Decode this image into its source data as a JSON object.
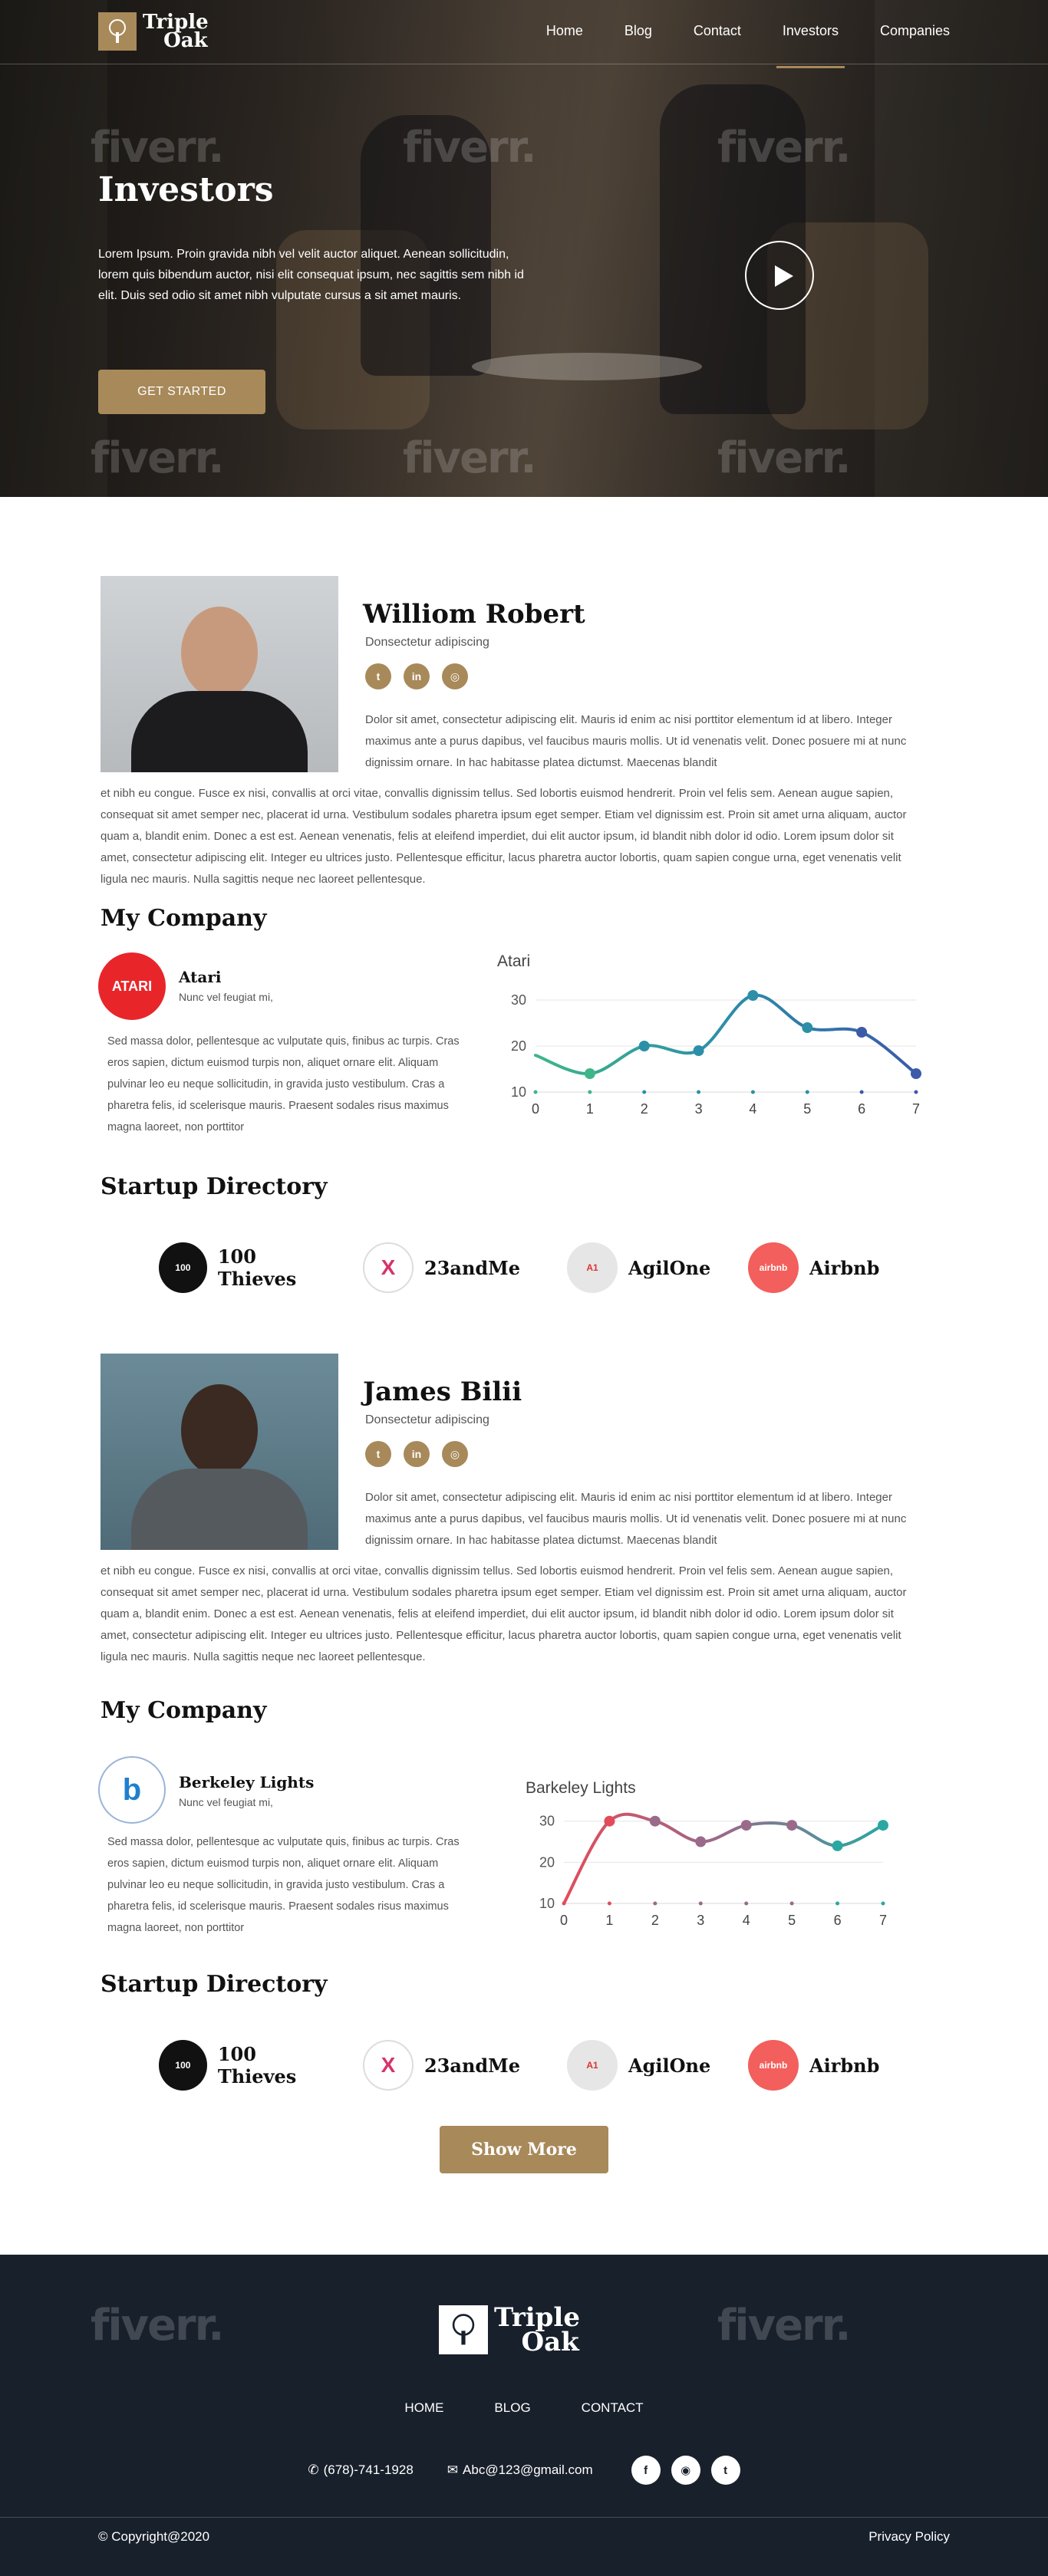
{
  "brand": {
    "name_line1": "Triple",
    "name_line2": "Oak"
  },
  "nav": {
    "items": [
      "Home",
      "Blog",
      "Contact",
      "Investors",
      "Companies"
    ],
    "active": "Investors"
  },
  "hero": {
    "title": "Investors",
    "text": "Lorem Ipsum. Proin gravida nibh vel velit auctor aliquet. Aenean sollicitudin, lorem quis bibendum auctor, nisi elit consequat ipsum, nec sagittis sem nibh id elit. Duis sed odio sit amet nibh vulputate cursus a sit amet mauris.",
    "cta": "GET STARTED"
  },
  "watermark": "fiverr.",
  "profiles": [
    {
      "name": "Williom Robert",
      "subtitle": "Donsectetur adipiscing",
      "bio_a": "Dolor sit amet, consectetur adipiscing elit. Mauris id enim ac nisi porttitor elementum id at libero. Integer maximus ante a purus dapibus, vel faucibus mauris mollis. Ut id venenatis velit. Donec posuere mi at nunc dignissim ornare. In hac habitasse platea dictumst. Maecenas blandit",
      "bio_b": "et nibh eu congue. Fusce ex nisi, convallis at orci vitae, convallis dignissim tellus. Sed lobortis euismod hendrerit. Proin vel felis sem. Aenean augue sapien, consequat sit amet semper nec, placerat id urna. Vestibulum sodales pharetra ipsum eget semper. Etiam vel dignissim est. Proin sit amet urna aliquam, auctor quam a, blandit enim. Donec a est est. Aenean venenatis, felis at eleifend imperdiet, dui elit auctor ipsum, id blandit nibh dolor id odio. Lorem ipsum dolor sit amet, consectetur adipiscing elit. Integer eu ultrices justo. Pellentesque efficitur, lacus pharetra auctor lobortis, quam sapien congue urna, eget venenatis velit ligula nec mauris. Nulla sagittis neque nec laoreet pellentesque.",
      "company_heading": "My Company",
      "company": {
        "name": "Atari",
        "logo_text": "ATARI",
        "tagline": "Nunc vel feugiat mi,",
        "desc": "Sed massa dolor, pellentesque ac vulputate quis, finibus ac turpis. Cras eros sapien, dictum euismod turpis non, aliquet ornare elit. Aliquam pulvinar leo eu neque sollicitudin, in gravida justo vestibulum. Cras a pharetra felis, id scelerisque mauris. Praesent sodales risus maximus magna laoreet, non porttitor",
        "color": "#e8262a"
      },
      "directory_heading": "Startup Directory"
    },
    {
      "name": "James Bilii",
      "subtitle": "Donsectetur adipiscing",
      "bio_a": "Dolor sit amet, consectetur adipiscing elit. Mauris id enim ac nisi porttitor elementum id at libero. Integer maximus ante a purus dapibus, vel faucibus mauris mollis. Ut id venenatis velit. Donec posuere mi at nunc dignissim ornare. In hac habitasse platea dictumst. Maecenas blandit",
      "bio_b": "et nibh eu congue. Fusce ex nisi, convallis at orci vitae, convallis dignissim tellus. Sed lobortis euismod hendrerit. Proin vel felis sem. Aenean augue sapien, consequat sit amet semper nec, placerat id urna. Vestibulum sodales pharetra ipsum eget semper. Etiam vel dignissim est. Proin sit amet urna aliquam, auctor quam a, blandit enim. Donec a est est. Aenean venenatis, felis at eleifend imperdiet, dui elit auctor ipsum, id blandit nibh dolor id odio. Lorem ipsum dolor sit amet, consectetur adipiscing elit. Integer eu ultrices justo. Pellentesque efficitur, lacus pharetra auctor lobortis, quam sapien congue urna, eget venenatis velit ligula nec mauris. Nulla sagittis neque nec laoreet pellentesque.",
      "company_heading": "My Company",
      "company": {
        "name": "Berkeley Lights",
        "logo_text": "b",
        "tagline": "Nunc vel feugiat mi,",
        "desc": "Sed massa dolor, pellentesque ac vulputate quis, finibus ac turpis. Cras eros sapien, dictum euismod turpis non, aliquet ornare elit. Aliquam pulvinar leo eu neque sollicitudin, in gravida justo vestibulum. Cras a pharetra felis, id scelerisque mauris. Praesent sodales risus maximus magna laoreet, non porttitor",
        "color": "#1f7fcf"
      },
      "directory_heading": "Startup Directory"
    }
  ],
  "directory": [
    {
      "name": "100 Thieves",
      "logo_text": "100",
      "bg": "#111111",
      "fg": "#ffffff"
    },
    {
      "name": "23andMe",
      "logo_text": "X",
      "bg": "#ffffff",
      "fg": "#d6336c"
    },
    {
      "name": "AgilOne",
      "logo_text": "A1",
      "bg": "#e6e6e6",
      "fg": "#d33"
    },
    {
      "name": "Airbnb",
      "logo_text": "airbnb",
      "bg": "#f25f5c",
      "fg": "#ffffff"
    }
  ],
  "chart_data": [
    {
      "type": "line",
      "title": "Atari",
      "x": [
        0,
        1,
        2,
        3,
        4,
        5,
        6,
        7
      ],
      "y": [
        18,
        14,
        20,
        19,
        31,
        24,
        23,
        14
      ],
      "ylim": [
        10,
        33
      ],
      "yticks": [
        10,
        20,
        30
      ],
      "gradient": [
        "#3fb58a",
        "#2b8fa8",
        "#3b5aa8"
      ]
    },
    {
      "type": "line",
      "title": "Barkeley Lights",
      "x": [
        0,
        1,
        2,
        3,
        4,
        5,
        6,
        7
      ],
      "y": [
        10,
        30,
        30,
        25,
        29,
        29,
        24,
        29
      ],
      "ylim": [
        10,
        32
      ],
      "yticks": [
        10,
        20,
        30
      ],
      "gradient": [
        "#e24c5a",
        "#9a6a8a",
        "#2aa7a2"
      ]
    }
  ],
  "show_more": "Show More",
  "footer": {
    "links": [
      "HOME",
      "BLOG",
      "CONTACT"
    ],
    "phone": "(678)-741-1928",
    "email": "Abc@123@gmail.com",
    "copyright": "© Copyright@2020",
    "privacy": "Privacy Policy"
  }
}
